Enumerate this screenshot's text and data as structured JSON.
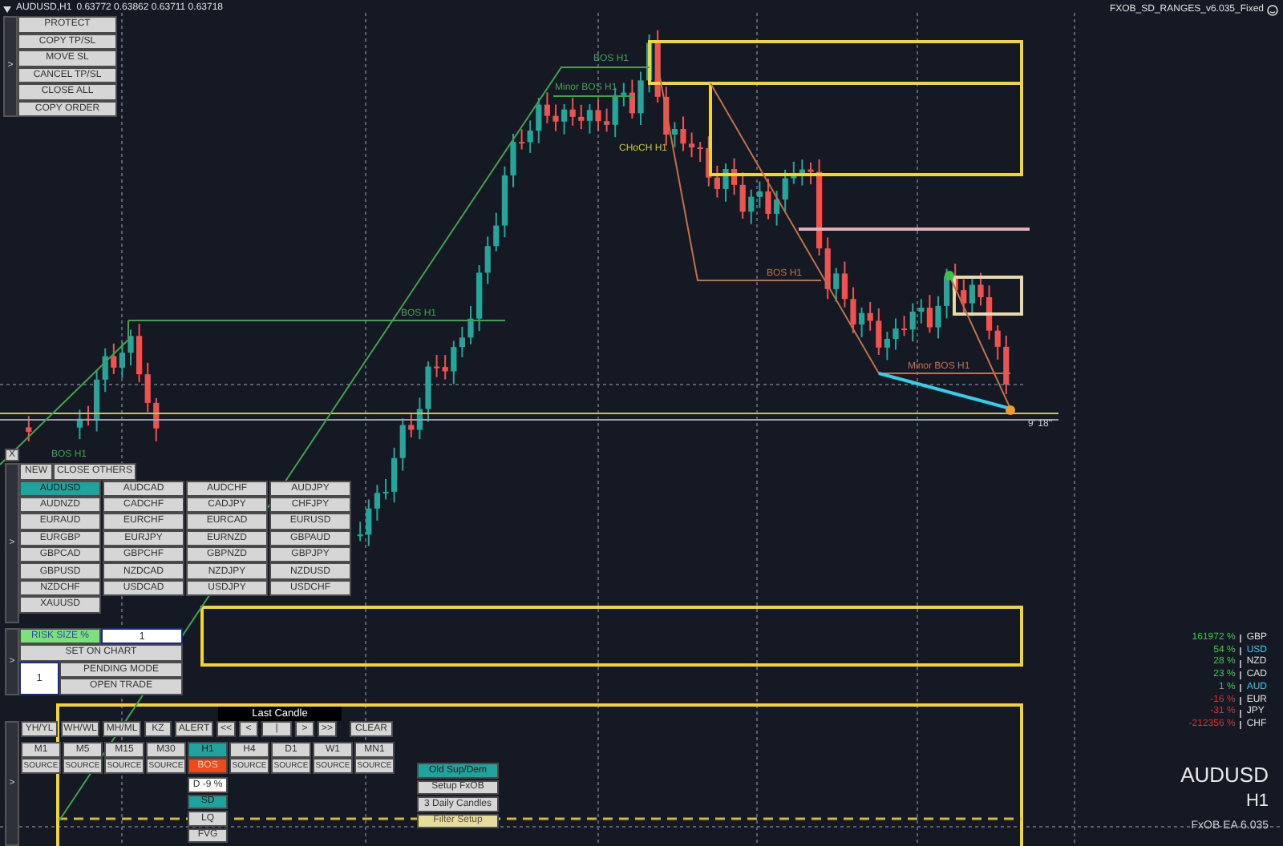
{
  "title_bar": {
    "symbol": "AUDUSD,H1",
    "prices": "0.63772 0.63862 0.63711 0.63718",
    "indicator": "FXOB_SD_RANGES_v6.035_Fixed"
  },
  "trade_panel": {
    "toggle": ">",
    "buttons": [
      "PROTECT",
      "COPY TP/SL",
      "MOVE SL",
      "CANCEL TP/SL",
      "CLOSE ALL",
      "COPY ORDER"
    ]
  },
  "symbol_panel": {
    "close": "X",
    "toggle": ">",
    "actions": [
      "NEW",
      "CLOSE OTHERS"
    ],
    "symbols": [
      {
        "label": "AUDUSD",
        "selected": true
      },
      {
        "label": "AUDCAD",
        "selected": false
      },
      {
        "label": "AUDCHF",
        "selected": false
      },
      {
        "label": "AUDJPY",
        "selected": false
      },
      {
        "label": "AUDNZD",
        "selected": false
      },
      {
        "label": "CADCHF",
        "selected": false
      },
      {
        "label": "CADJPY",
        "selected": false
      },
      {
        "label": "CHFJPY",
        "selected": false
      },
      {
        "label": "EURAUD",
        "selected": false
      },
      {
        "label": "EURCHF",
        "selected": false
      },
      {
        "label": "EURCAD",
        "selected": false
      },
      {
        "label": "EURUSD",
        "selected": false
      },
      {
        "label": "EURGBP",
        "selected": false
      },
      {
        "label": "EURJPY",
        "selected": false
      },
      {
        "label": "EURNZD",
        "selected": false
      },
      {
        "label": "GBPAUD",
        "selected": false
      },
      {
        "label": "GBPCAD",
        "selected": false
      },
      {
        "label": "GBPCHF",
        "selected": false
      },
      {
        "label": "GBPNZD",
        "selected": false
      },
      {
        "label": "GBPJPY",
        "selected": false
      },
      {
        "label": "GBPUSD",
        "selected": false
      },
      {
        "label": "NZDCAD",
        "selected": false
      },
      {
        "label": "NZDJPY",
        "selected": false
      },
      {
        "label": "NZDUSD",
        "selected": false
      },
      {
        "label": "NZDCHF",
        "selected": false
      },
      {
        "label": "USDCAD",
        "selected": false
      },
      {
        "label": "USDJPY",
        "selected": false
      },
      {
        "label": "USDCHF",
        "selected": false
      },
      {
        "label": "XAUUSD",
        "selected": false
      }
    ]
  },
  "risk_panel": {
    "toggle": ">",
    "risk_label": "RISK SIZE %",
    "risk_value": "1",
    "set_on_chart": "SET ON CHART",
    "lots_value": "1",
    "pending_mode": "PENDING MODE",
    "open_trade": "OPEN TRADE"
  },
  "chart_labels": [
    {
      "text": "BOS H1",
      "color": "#3fa34d"
    },
    {
      "text": "Minor BOS H1",
      "color": "#3fa34d"
    },
    {
      "text": "BOS H1",
      "color": "#3fa34d"
    },
    {
      "text": "CHoCH H1",
      "color": "#c8c832"
    },
    {
      "text": "BOS H1",
      "color": "#c0704a"
    },
    {
      "text": "Minor BOS H1",
      "color": "#c0704a"
    },
    {
      "text": "BOS H1",
      "color": "#3fa34d"
    }
  ],
  "time_label": "9' 18''",
  "tools_panel": {
    "toggle": ">",
    "last_candle": "Last Candle",
    "controls": [
      "YH/YL",
      "WH/WL",
      "MH/ML",
      "KZ",
      "ALERT",
      "<<",
      "<",
      "|",
      ">",
      ">>",
      "CLEAR"
    ],
    "timeframes": [
      {
        "label": "M1",
        "selected": false
      },
      {
        "label": "M5",
        "selected": false
      },
      {
        "label": "M15",
        "selected": false
      },
      {
        "label": "M30",
        "selected": false
      },
      {
        "label": "H1",
        "selected": true
      },
      {
        "label": "H4",
        "selected": false
      },
      {
        "label": "D1",
        "selected": false
      },
      {
        "label": "W1",
        "selected": false
      },
      {
        "label": "MN1",
        "selected": false
      }
    ],
    "sources": [
      {
        "label": "SOURCE",
        "kind": "source"
      },
      {
        "label": "SOURCE",
        "kind": "source"
      },
      {
        "label": "SOURCE",
        "kind": "source"
      },
      {
        "label": "SOURCE",
        "kind": "source"
      },
      {
        "label": "BOS",
        "kind": "bos"
      },
      {
        "label": "SOURCE",
        "kind": "source"
      },
      {
        "label": "SOURCE",
        "kind": "source"
      },
      {
        "label": "SOURCE",
        "kind": "source"
      },
      {
        "label": "SOURCE",
        "kind": "source"
      }
    ],
    "options": [
      {
        "label": "D -9 %",
        "kind": "readout"
      },
      {
        "label": "SD",
        "kind": "active"
      },
      {
        "label": "LQ",
        "kind": "normal"
      },
      {
        "label": "FVG",
        "kind": "normal"
      }
    ],
    "setup_buttons": [
      {
        "label": "Old Sup/Dem",
        "kind": "active"
      },
      {
        "label": "Setup FxOB",
        "kind": "normal"
      },
      {
        "label": "3 Daily Candles",
        "kind": "normal"
      },
      {
        "label": "Filter Setup",
        "kind": "filter"
      }
    ]
  },
  "strength": [
    {
      "value": "161972 %",
      "color": "#2ecc40",
      "currency": "GBP",
      "selected": false
    },
    {
      "value": "54 %",
      "color": "#2ecc40",
      "currency": "USD",
      "selected": true
    },
    {
      "value": "28 %",
      "color": "#2ecc40",
      "currency": "NZD",
      "selected": false
    },
    {
      "value": "23 %",
      "color": "#2ecc40",
      "currency": "CAD",
      "selected": false
    },
    {
      "value": "1 %",
      "color": "#2ecc40",
      "currency": "AUD",
      "selected": true
    },
    {
      "value": "-16 %",
      "color": "#e0302a",
      "currency": "EUR",
      "selected": false
    },
    {
      "value": "-31 %",
      "color": "#e0302a",
      "currency": "JPY",
      "selected": false
    },
    {
      "value": "-212356 %",
      "color": "#e0302a",
      "currency": "CHF",
      "selected": false
    }
  ],
  "symbol_info": {
    "symbol": "AUDUSD",
    "timeframe": "H1",
    "version": "FxOB EA 6.035"
  }
}
